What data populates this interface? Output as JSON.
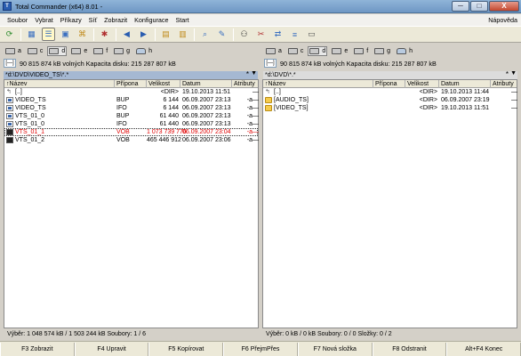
{
  "window": {
    "title": "Total Commander (x64) 8.01 -",
    "app_icon": "tc-logo-icon",
    "buttons": [
      "─",
      "□",
      "X"
    ]
  },
  "menu": {
    "items": [
      "Soubor",
      "Vybrat",
      "Příkazy",
      "Síť",
      "Zobrazit",
      "Konfigurace",
      "Start"
    ],
    "help": "Nápověda"
  },
  "toolbar": {
    "buttons": [
      "refresh-icon",
      "brief-view-icon",
      "detailed-view-icon",
      "thumbnail-view-icon",
      "tree-view-icon",
      "invert-selection-icon",
      "back-icon",
      "forward-icon",
      "pack-icon",
      "unpack-icon",
      "find-files-icon",
      "multi-rename-icon",
      "ftp-connect-icon",
      "ftp-disconnect-icon",
      "sync-dirs-icon",
      "compare-icon",
      "notepad-icon"
    ]
  },
  "left": {
    "drives": [
      {
        "letter": "a",
        "active": false
      },
      {
        "letter": "c",
        "active": false
      },
      {
        "letter": "d",
        "active": true
      },
      {
        "letter": "e",
        "active": false
      },
      {
        "letter": "f",
        "active": false
      },
      {
        "letter": "g",
        "active": false
      },
      {
        "letter": "h",
        "active": false
      }
    ],
    "drive_combo": "[—]",
    "free_text": "90 815 874 kB volných  Kapacita disku: 215 287 807 kB",
    "path": "*d:\\DVD\\VIDEO_TS\\*.*",
    "path_star": "*",
    "path_arrow": "▼",
    "columns": {
      "name": "↑Název",
      "ext": "Přípona",
      "size": "Velikost",
      "date": "Datum",
      "attr": "Atributy"
    },
    "rows": [
      {
        "icon": "up",
        "name": "[..]",
        "ext": "",
        "size": "<DIR>",
        "date": "19.10.2013 11:51",
        "attr": "—",
        "style": ""
      },
      {
        "icon": "file",
        "name": "VIDEO_TS",
        "ext": "BUP",
        "size": "6 144",
        "date": "06.09.2007 23:13",
        "attr": "-a—",
        "style": ""
      },
      {
        "icon": "file",
        "name": "VIDEO_TS",
        "ext": "IFO",
        "size": "6 144",
        "date": "06.09.2007 23:13",
        "attr": "-a—",
        "style": ""
      },
      {
        "icon": "file",
        "name": "VTS_01_0",
        "ext": "BUP",
        "size": "61 440",
        "date": "06.09.2007 23:13",
        "attr": "-a—",
        "style": ""
      },
      {
        "icon": "file",
        "name": "VTS_01_0",
        "ext": "IFO",
        "size": "61 440",
        "date": "06.09.2007 23:13",
        "attr": "-a—",
        "style": ""
      },
      {
        "icon": "video",
        "name": "VTS_01_1",
        "ext": "VOB",
        "size": "1 073 739 776",
        "date": "06.09.2007 23:04",
        "attr": "-a—",
        "style": "red focus"
      },
      {
        "icon": "video",
        "name": "VTS_01_2",
        "ext": "VOB",
        "size": "465 446 912",
        "date": "06.09.2007 23:06",
        "attr": "-a—",
        "style": ""
      }
    ],
    "status": "Výběr: 1 048 574 kB / 1 503 244 kB  Soubory: 1 / 6"
  },
  "right": {
    "drives": [
      {
        "letter": "a",
        "active": false
      },
      {
        "letter": "c",
        "active": false
      },
      {
        "letter": "d",
        "active": true
      },
      {
        "letter": "e",
        "active": false
      },
      {
        "letter": "f",
        "active": false
      },
      {
        "letter": "g",
        "active": false
      },
      {
        "letter": "h",
        "active": false
      }
    ],
    "drive_combo": "[—]",
    "free_text": "90 815 874 kB volných  Kapacita disku: 215 287 807 kB",
    "path": "*d:\\DVD\\*.*",
    "path_star": "*",
    "path_arrow": "▼",
    "columns": {
      "name": "↑Název",
      "ext": "Přípona",
      "size": "Velikost",
      "date": "Datum",
      "attr": "Atributy"
    },
    "rows": [
      {
        "icon": "up",
        "name": "[..]",
        "ext": "",
        "size": "<DIR>",
        "date": "19.10.2013 11:44",
        "attr": "—",
        "style": ""
      },
      {
        "icon": "folder",
        "name": "[AUDIO_TS]",
        "ext": "",
        "size": "<DIR>",
        "date": "06.09.2007 23:19",
        "attr": "—",
        "style": ""
      },
      {
        "icon": "folder",
        "name": "[VIDEO_TS]",
        "ext": "",
        "size": "<DIR>",
        "date": "19.10.2013 11:51",
        "attr": "—",
        "style": ""
      }
    ],
    "status": "Výběr: 0 kB / 0 kB  Soubory: 0 / 0  Složky: 0 / 2"
  },
  "fkeys": [
    "F3 Zobrazit",
    "F4 Upravit",
    "F5 Kopírovat",
    "F6 PřejmPřes",
    "F7 Nová složka",
    "F8 Odstranit",
    "Alt+F4 Konec"
  ]
}
